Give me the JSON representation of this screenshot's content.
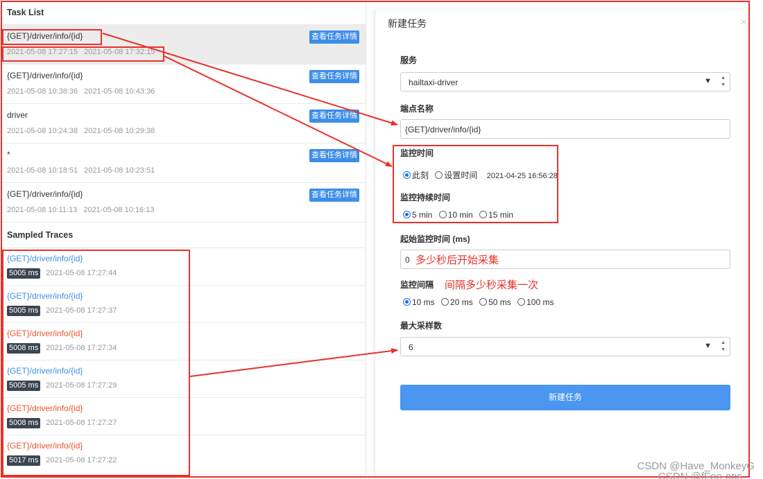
{
  "task_list": {
    "title": "Task List",
    "detail_label": "查看任务详情",
    "items": [
      {
        "endpoint": "{GET}/driver/info/{id}",
        "start": "2021-05-08 17:27:15",
        "end": "2021-05-08 17:32:15"
      },
      {
        "endpoint": "{GET}/driver/info/{id}",
        "start": "2021-05-08 10:38:36",
        "end": "2021-05-08 10:43:36"
      },
      {
        "endpoint": "driver",
        "start": "2021-05-08 10:24:38",
        "end": "2021-05-08 10:29:38"
      },
      {
        "endpoint": "*",
        "start": "2021-05-08 10:18:51",
        "end": "2021-05-08 10:23:51"
      },
      {
        "endpoint": "{GET}/driver/info/{id}",
        "start": "2021-05-08 10:11:13",
        "end": "2021-05-08 10:16:13"
      }
    ]
  },
  "sampled_traces": {
    "title": "Sampled Traces",
    "items": [
      {
        "endpoint": "{GET}/driver/info/{id}",
        "duration": "5005 ms",
        "time": "2021-05-08 17:27:44",
        "color": "#3d8ee8"
      },
      {
        "endpoint": "{GET}/driver/info/{id}",
        "duration": "5005 ms",
        "time": "2021-05-08 17:27:37",
        "color": "#3d8ee8"
      },
      {
        "endpoint": "{GET}/driver/info/{id}",
        "duration": "5008 ms",
        "time": "2021-05-08 17:27:34",
        "color": "#e8542f"
      },
      {
        "endpoint": "{GET}/driver/info/{id}",
        "duration": "5005 ms",
        "time": "2021-05-08 17:27:29",
        "color": "#3d8ee8"
      },
      {
        "endpoint": "{GET}/driver/info/{id}",
        "duration": "5008 ms",
        "time": "2021-05-08 17:27:27",
        "color": "#e8542f"
      },
      {
        "endpoint": "{GET}/driver/info/{id}",
        "duration": "5017 ms",
        "time": "2021-05-08 17:27:22",
        "color": "#e8542f"
      }
    ]
  },
  "modal": {
    "title": "新建任务",
    "close_icon": "×",
    "service_label": "服务",
    "service_value": "hailtaxi-driver",
    "endpoint_label": "端点名称",
    "endpoint_value": "{GET}/driver/info/{id}",
    "monitor_time_label": "监控时间",
    "monitor_time_options": [
      "此刻",
      "设置时间"
    ],
    "monitor_time_selected": 0,
    "monitor_time_value": "2021-04-25 16:56:28",
    "duration_label": "监控持续时间",
    "duration_options": [
      "5 min",
      "10 min",
      "15 min"
    ],
    "duration_selected": 0,
    "start_delay_label": "起始监控时间 (ms)",
    "start_delay_value": "0",
    "start_delay_note": "多少秒后开始采集",
    "interval_label": "监控间隔",
    "interval_note": "间隔多少秒采集一次",
    "interval_options": [
      "10 ms",
      "20 ms",
      "50 ms",
      "100 ms"
    ],
    "interval_selected": 0,
    "max_samples_label": "最大采样数",
    "max_samples_value": "6",
    "submit_label": "新建任务"
  },
  "watermarks": [
    "CSDN @Have_MonkeyG",
    "CSDN @fFee-ops"
  ],
  "colors": {
    "accent": "#3d8ee8",
    "primary_button": "#4a96f0",
    "annotation": "#e8312a",
    "error_trace": "#e8542f"
  }
}
